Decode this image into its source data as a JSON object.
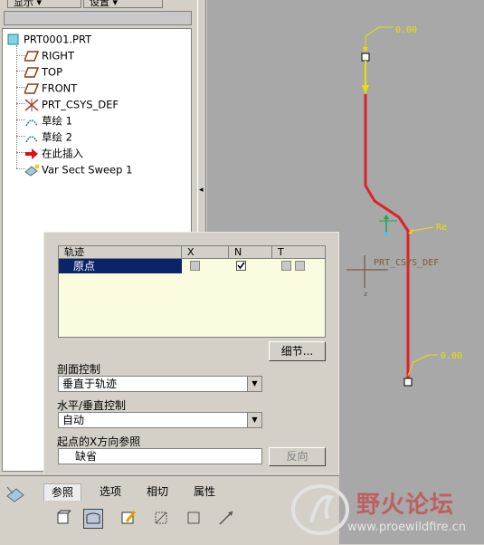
{
  "toolbar": {
    "display_btn": "显示",
    "settings_btn": "设置"
  },
  "tree": {
    "items": [
      {
        "label": "PRT0001.PRT",
        "icon": "part-icon"
      },
      {
        "label": "RIGHT",
        "icon": "datum-plane-icon"
      },
      {
        "label": "TOP",
        "icon": "datum-plane-icon"
      },
      {
        "label": "FRONT",
        "icon": "datum-plane-icon"
      },
      {
        "label": "PRT_CSYS_DEF",
        "icon": "csys-icon"
      },
      {
        "label": "草绘 1",
        "icon": "sketch-icon"
      },
      {
        "label": "草绘 2",
        "icon": "sketch-icon"
      },
      {
        "label": "在此插入",
        "icon": "insert-here-arrow-icon"
      },
      {
        "label": "Var Sect Sweep 1",
        "icon": "var-sect-sweep-icon"
      }
    ]
  },
  "graphics": {
    "label_top": "0.00",
    "label_mid": "Re",
    "label_csys": "PRT_CSYS_DEF",
    "label_bottom": "0.00",
    "trajectory_color": "#e0202a"
  },
  "dashboard": {
    "table": {
      "headers": [
        "轨迹",
        "X",
        "N",
        "T"
      ],
      "rows": [
        {
          "name": "原点",
          "x_checked": false,
          "n_checked": true,
          "t_checked": false
        }
      ]
    },
    "details_btn": "细节...",
    "section_control_label": "剖面控制",
    "section_control_value": "垂直于轨迹",
    "hv_control_label": "水平/垂直控制",
    "hv_control_value": "自动",
    "x_ref_label": "起点的X方向参照",
    "x_ref_value": "缺省",
    "flip_btn": "反向"
  },
  "tabs": [
    {
      "label": "参照",
      "active": true
    },
    {
      "label": "选项",
      "active": false
    },
    {
      "label": "相切",
      "active": false
    },
    {
      "label": "属性",
      "active": false
    }
  ],
  "watermark": {
    "title": "野火论坛",
    "url": "www.proewildfire.cn"
  }
}
